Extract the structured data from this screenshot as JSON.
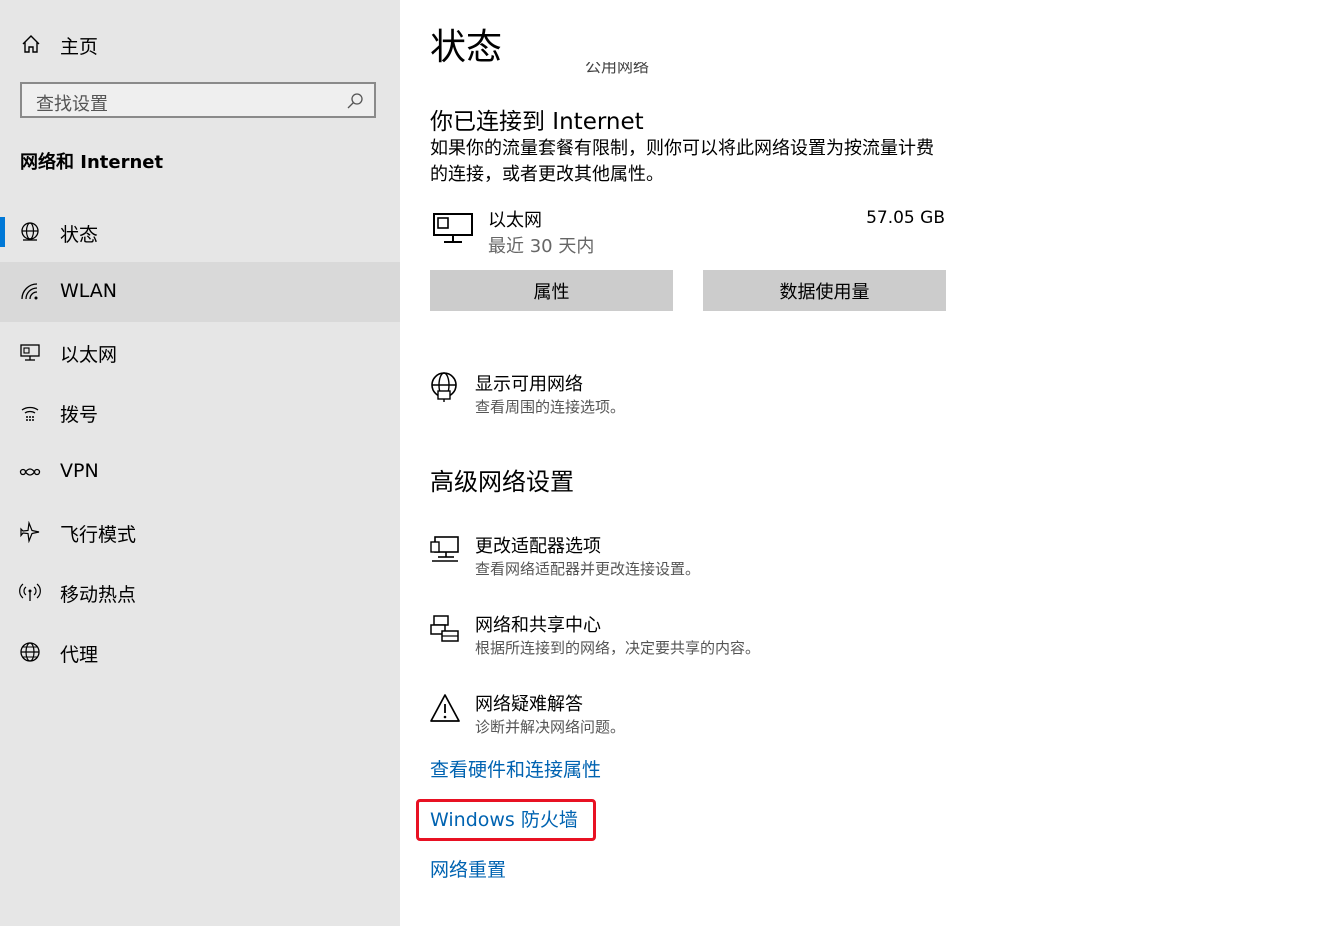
{
  "sidebar": {
    "home_label": "主页",
    "search_placeholder": "查找设置",
    "section_title": "网络和 Internet",
    "items": [
      {
        "label": "状态",
        "icon": "globe-status-icon",
        "selected": true
      },
      {
        "label": "WLAN",
        "icon": "wifi-icon",
        "hovered": true
      },
      {
        "label": "以太网",
        "icon": "ethernet-icon"
      },
      {
        "label": "拨号",
        "icon": "dialup-icon"
      },
      {
        "label": "VPN",
        "icon": "vpn-icon"
      },
      {
        "label": "飞行模式",
        "icon": "airplane-icon"
      },
      {
        "label": "移动热点",
        "icon": "hotspot-icon"
      },
      {
        "label": "代理",
        "icon": "globe-icon"
      }
    ]
  },
  "main": {
    "title": "状态",
    "clipped_text": "公用网络",
    "connection_heading": "你已连接到 Internet",
    "connection_desc": "如果你的流量套餐有限制，则你可以将此网络设置为按流量计费的连接，或者更改其他属性。",
    "adapter": {
      "name": "以太网",
      "period": "最近 30 天内",
      "usage": "57.05 GB"
    },
    "buttons": {
      "properties": "属性",
      "data_usage": "数据使用量"
    },
    "show_networks": {
      "title": "显示可用网络",
      "subtitle": "查看周围的连接选项。"
    },
    "advanced_heading": "高级网络设置",
    "advanced": [
      {
        "title": "更改适配器选项",
        "subtitle": "查看网络适配器并更改连接设置。",
        "icon": "adapter-icon"
      },
      {
        "title": "网络和共享中心",
        "subtitle": "根据所连接到的网络，决定要共享的内容。",
        "icon": "sharing-center-icon"
      },
      {
        "title": "网络疑难解答",
        "subtitle": "诊断并解决网络问题。",
        "icon": "warning-icon"
      }
    ],
    "links": {
      "hardware": "查看硬件和连接属性",
      "firewall": "Windows 防火墙",
      "reset": "网络重置"
    }
  },
  "colors": {
    "sidebar_bg": "#e6e6e6",
    "accent": "#0078d7",
    "link": "#0063b1",
    "highlight": "#e81123"
  }
}
